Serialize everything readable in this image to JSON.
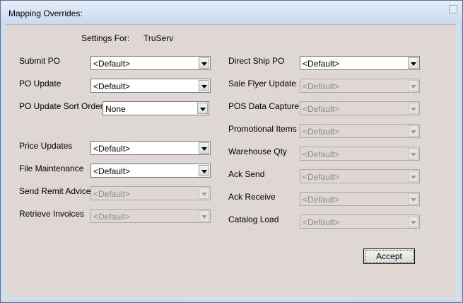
{
  "window": {
    "title": "Mapping Overrides:"
  },
  "settings": {
    "label": "Settings For:",
    "value": "TruServ"
  },
  "left_fields": [
    {
      "label": "Submit PO",
      "value": "<Default>",
      "enabled": true
    },
    {
      "label": "PO Update",
      "value": "<Default>",
      "enabled": true
    },
    {
      "label": "PO Update Sort Order:",
      "value": "None",
      "enabled": true
    },
    {
      "label": "Price Updates",
      "value": "<Default>",
      "enabled": true
    },
    {
      "label": "File Maintenance",
      "value": "<Default>",
      "enabled": true
    },
    {
      "label": "Send Remit Advice",
      "value": "<Default>",
      "enabled": false
    },
    {
      "label": "Retrieve Invoices",
      "value": "<Default>",
      "enabled": false
    }
  ],
  "right_fields": [
    {
      "label": "Direct Ship PO",
      "value": "<Default>",
      "enabled": true
    },
    {
      "label": "Sale Flyer Update",
      "value": "<Default>",
      "enabled": false
    },
    {
      "label": "POS Data Capture",
      "value": "<Default>",
      "enabled": false
    },
    {
      "label": "Promotional Items",
      "value": "<Default>",
      "enabled": false
    },
    {
      "label": "Warehouse Qty",
      "value": "<Default>",
      "enabled": false
    },
    {
      "label": "Ack Send",
      "value": "<Default>",
      "enabled": false
    },
    {
      "label": "Ack Receive",
      "value": "<Default>",
      "enabled": false
    },
    {
      "label": "Catalog Load",
      "value": "<Default>",
      "enabled": false
    }
  ],
  "buttons": {
    "accept": "Accept"
  }
}
